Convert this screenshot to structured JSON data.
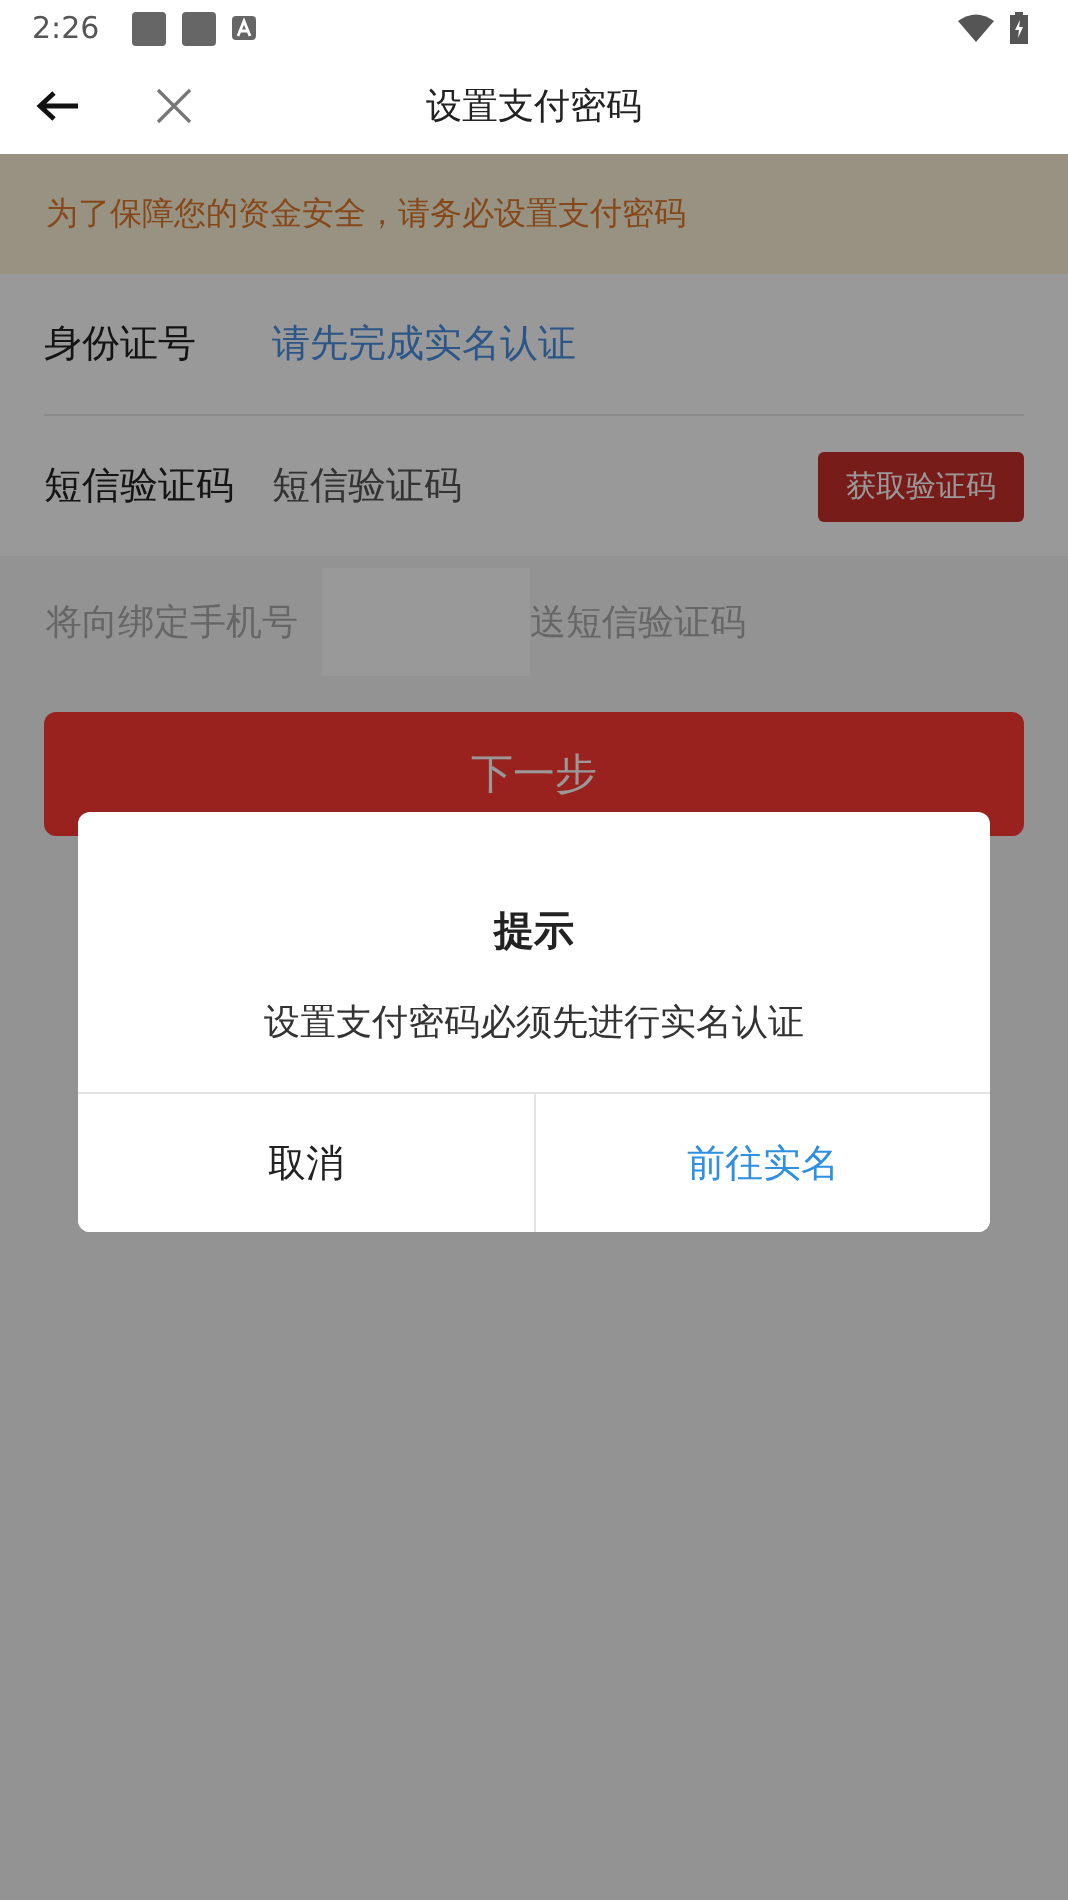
{
  "status_bar": {
    "time": "2:26"
  },
  "header": {
    "title": "设置支付密码"
  },
  "banner": {
    "text": "为了保障您的资金安全，请务必设置支付密码"
  },
  "form": [
    {
      "kind": "link",
      "label": "身份证号",
      "value": "请先完成实名认证"
    },
    {
      "kind": "input",
      "label": "短信验证码",
      "placeholder": "短信验证码",
      "button": "获取验证码"
    }
  ],
  "hint": {
    "before": "将向绑定手机号",
    "after": "送短信验证码"
  },
  "next_button": "下一步",
  "dialog": {
    "title": "提示",
    "message": "设置支付密码必须先进行实名认证",
    "buttons": [
      {
        "label": "取消",
        "primary": false
      },
      {
        "label": "前往实名",
        "primary": true
      }
    ]
  }
}
